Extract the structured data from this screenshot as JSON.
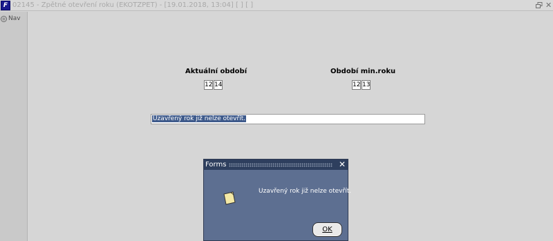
{
  "window": {
    "title": "02145 - Zpětné otevření roku (EKOTZPET) - [19.01.2018, 13:04] [ ] [ ]",
    "app_icon": "F"
  },
  "sidebar": {
    "nav_label": "Nav"
  },
  "form": {
    "current_period_label": "Aktuální období",
    "current_period": [
      "12",
      "14"
    ],
    "min_period_label": "Období min.roku",
    "min_period": [
      "12",
      "13"
    ],
    "message": "Uzavřený rok již nelze otevřít."
  },
  "dialog": {
    "title": "Forms",
    "message": "Uzavřený rok již nelze otevřít.",
    "ok_label": "OK"
  },
  "icons": {
    "app": "forms-app-icon",
    "restore": "restore-window-icon",
    "close": "close-icon",
    "nav": "nav-icon",
    "note": "note-icon"
  }
}
